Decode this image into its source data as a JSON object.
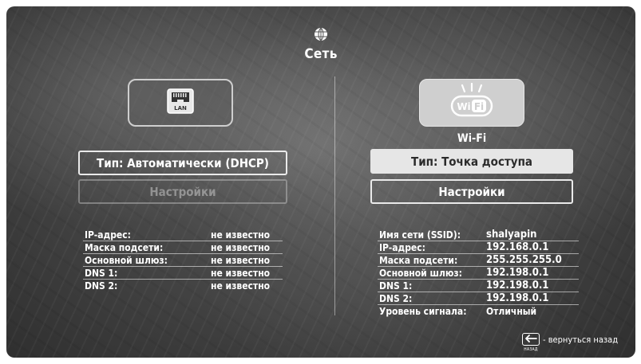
{
  "header": {
    "title": "Сеть",
    "icon": "globe-icon"
  },
  "lan": {
    "icon": "lan-port-icon",
    "icon_text": "LAN",
    "type_button": "Тип: Автоматически (DHCP)",
    "settings_button": "Настройки",
    "rows": [
      {
        "label": "IP-адрес:",
        "value": "не известно"
      },
      {
        "label": "Маска подсети:",
        "value": "не известно"
      },
      {
        "label": "Основной шлюз:",
        "value": "не известно"
      },
      {
        "label": "DNS 1:",
        "value": "не известно"
      },
      {
        "label": "DNS 2:",
        "value": "не известно"
      }
    ]
  },
  "wifi": {
    "icon": "wifi-icon",
    "icon_text_a": "Wi",
    "icon_text_b": "Fi",
    "label": "Wi-Fi",
    "type_button": "Тип: Точка доступа",
    "settings_button": "Настройки",
    "rows": [
      {
        "label": "Имя сети (SSID):",
        "value": "shalyapin"
      },
      {
        "label": "IP-адрес:",
        "value": "192.168.0.1"
      },
      {
        "label": "Маска подсети:",
        "value": "255.255.255.0"
      },
      {
        "label": "Основной шлюз:",
        "value": "192.198.0.1"
      },
      {
        "label": "DNS 1:",
        "value": "192.198.0.1"
      },
      {
        "label": "DNS 2:",
        "value": "192.198.0.1"
      },
      {
        "label": "Уровень сигнала:",
        "value": "Отличный"
      }
    ]
  },
  "back": {
    "icon": "back-arrow-icon",
    "key_caption": "НАЗАД",
    "label": "- вернуться назад"
  }
}
